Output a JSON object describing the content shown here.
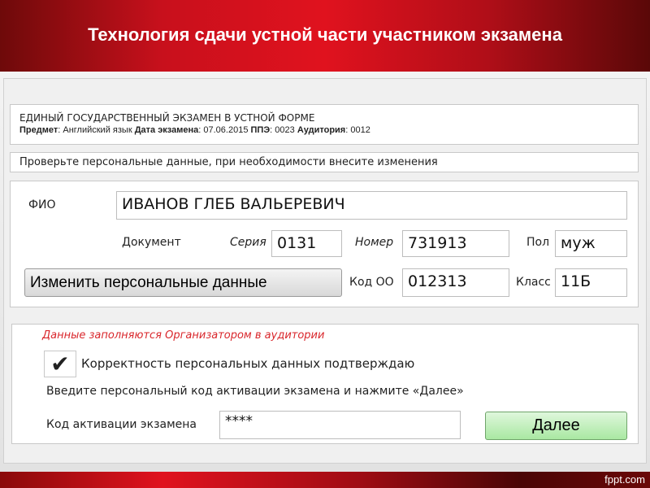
{
  "header": {
    "title": "Технология сдачи устной части участником экзамена"
  },
  "info": {
    "title": "ЕДИНЫЙ ГОСУДАРСТВЕННЫЙ ЭКЗАМЕН В УСТНОЙ ФОРМЕ",
    "subject_label": "Предмет",
    "subject": "Английский язык",
    "date_label": "Дата экзамена",
    "date": "07.06.2015",
    "ppe_label": "ППЭ",
    "ppe": "0023",
    "room_label": "Аудитория",
    "room": "0012"
  },
  "notice": "Проверьте персональные данные, при необходимости внесите изменения",
  "person": {
    "fio_label": "ФИО",
    "fio": "ИВАНОВ ГЛЕБ ВАЛЬЕРЕВИЧ",
    "doc_label": "Документ",
    "series_label": "Серия",
    "series": "0131",
    "number_label": "Номер",
    "number": "731913",
    "sex_label": "Пол",
    "sex": "муж",
    "edit_button": "Изменить персональные данные",
    "school_label": "Код ОО",
    "school": "012313",
    "class_label": "Класс",
    "class": "11Б"
  },
  "activation": {
    "organizer_note": "Данные заполняются Организатором в аудитории",
    "confirm_label": "Корректность персональных данных подтверждаю",
    "confirm_checked": true,
    "instruction": "Введите персональный код активации экзамена и нажмите «Далее»",
    "code_label": "Код активации экзамена",
    "code_value": "****",
    "next_button": "Далее"
  },
  "footer": {
    "brand": "fppt.com"
  }
}
